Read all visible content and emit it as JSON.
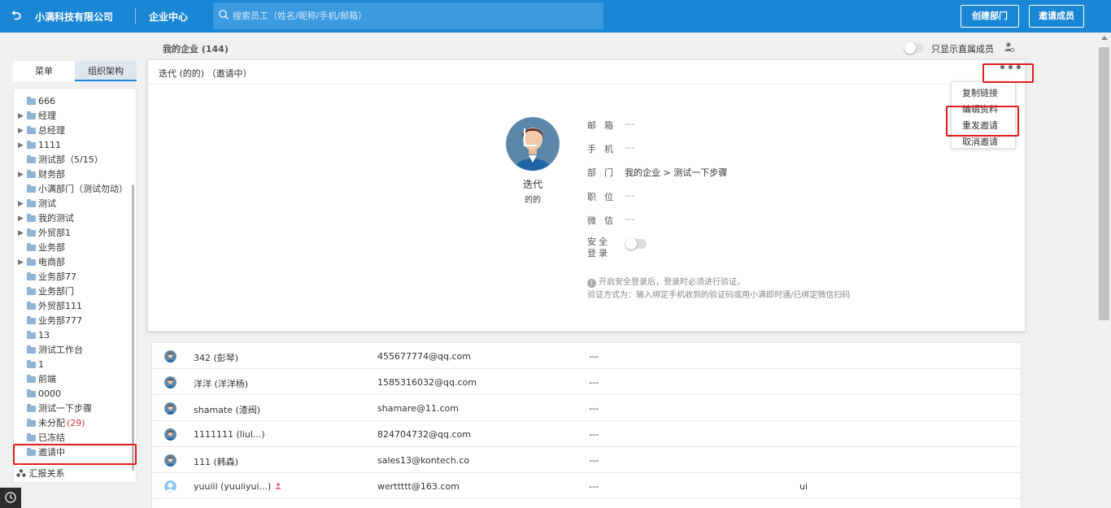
{
  "topbar": {
    "back_icon": "back-arrow-icon",
    "company": "小满科技有限公司",
    "center": "企业中心",
    "search_placeholder": "搜索员工（姓名/昵称/手机/邮箱）",
    "create_dept": "创建部门",
    "invite_member": "邀请成员"
  },
  "header": {
    "my_enterprise": "我的企业 (144)",
    "only_direct": "只显示直属成员"
  },
  "sidebar": {
    "tabs": [
      "菜单",
      "组织架构"
    ],
    "items": [
      {
        "name": "666",
        "expandable": false
      },
      {
        "name": "经理",
        "expandable": true
      },
      {
        "name": "总经理",
        "expandable": true
      },
      {
        "name": "1111",
        "expandable": true
      },
      {
        "name": "测试部（5/15）",
        "expandable": false
      },
      {
        "name": "财务部",
        "expandable": true
      },
      {
        "name": "小满部门（测试勿动）",
        "expandable": false
      },
      {
        "name": "测试",
        "expandable": true
      },
      {
        "name": "我的测试",
        "expandable": true
      },
      {
        "name": "外贸部1",
        "expandable": true
      },
      {
        "name": "业务部",
        "expandable": false
      },
      {
        "name": "电商部",
        "expandable": true
      },
      {
        "name": "业务部77",
        "expandable": false
      },
      {
        "name": "业务部门",
        "expandable": false
      },
      {
        "name": "外贸部111",
        "expandable": false
      },
      {
        "name": "业务部777",
        "expandable": false
      },
      {
        "name": "13",
        "expandable": false
      },
      {
        "name": "测试工作台",
        "expandable": false
      },
      {
        "name": "1",
        "expandable": false
      },
      {
        "name": "前端",
        "expandable": false
      },
      {
        "name": "0000",
        "expandable": false
      },
      {
        "name": "测试一下步骤",
        "expandable": false
      },
      {
        "name": "未分配",
        "count": "(29)",
        "expandable": false
      },
      {
        "name": "已冻结",
        "expandable": false
      },
      {
        "name": "邀请中",
        "expandable": false
      }
    ],
    "report": "汇报关系"
  },
  "detail": {
    "title": "迭代 (的的) （邀请中）",
    "more": "•••",
    "name": "迭代",
    "nickname": "的的",
    "fields": [
      {
        "label": "邮箱",
        "value": "---"
      },
      {
        "label": "手机",
        "value": "---"
      },
      {
        "label": "部门",
        "value": "我的企业 > 测试一下步骤"
      },
      {
        "label": "职位",
        "value": "---"
      },
      {
        "label": "微信",
        "value": "---"
      }
    ],
    "secure_login_label": "安全登录",
    "note_line1": "开启安全登录后，登录时必须进行验证，",
    "note_line2": "验证方式为：输入绑定手机收到的验证码或用小满即时通/已绑定微信扫码"
  },
  "dropdown": {
    "items": [
      "复制链接",
      "编辑资料",
      "重发邀请",
      "取消邀请"
    ]
  },
  "members": [
    {
      "name": "342 (彭琴)",
      "email": "455677774@qq.com",
      "position": "---",
      "extra": "",
      "avatar": "male"
    },
    {
      "name": "洋洋 (洋洋杨)",
      "email": "1585316032@qq.com",
      "position": "---",
      "extra": "",
      "avatar": "male"
    },
    {
      "name": "shamate (渣阀)",
      "email": "shamare@11.com",
      "position": "---",
      "extra": "",
      "avatar": "male"
    },
    {
      "name": "1111111 (liul...)",
      "email": "824704732@qq.com",
      "position": "---",
      "extra": "",
      "avatar": "male"
    },
    {
      "name": "111 (韩森)",
      "email": "sales13@kontech.co",
      "position": "---",
      "extra": "",
      "avatar": "male"
    },
    {
      "name": "yuuiii (yuuiiyui...)",
      "email": "werttttt@163.com",
      "position": "---",
      "extra": "ui",
      "avatar": "light",
      "pink_icon": true
    }
  ],
  "colors": {
    "primary": "#1a86d6",
    "highlight": "#e41c1c",
    "count_red": "#e03a3a"
  }
}
